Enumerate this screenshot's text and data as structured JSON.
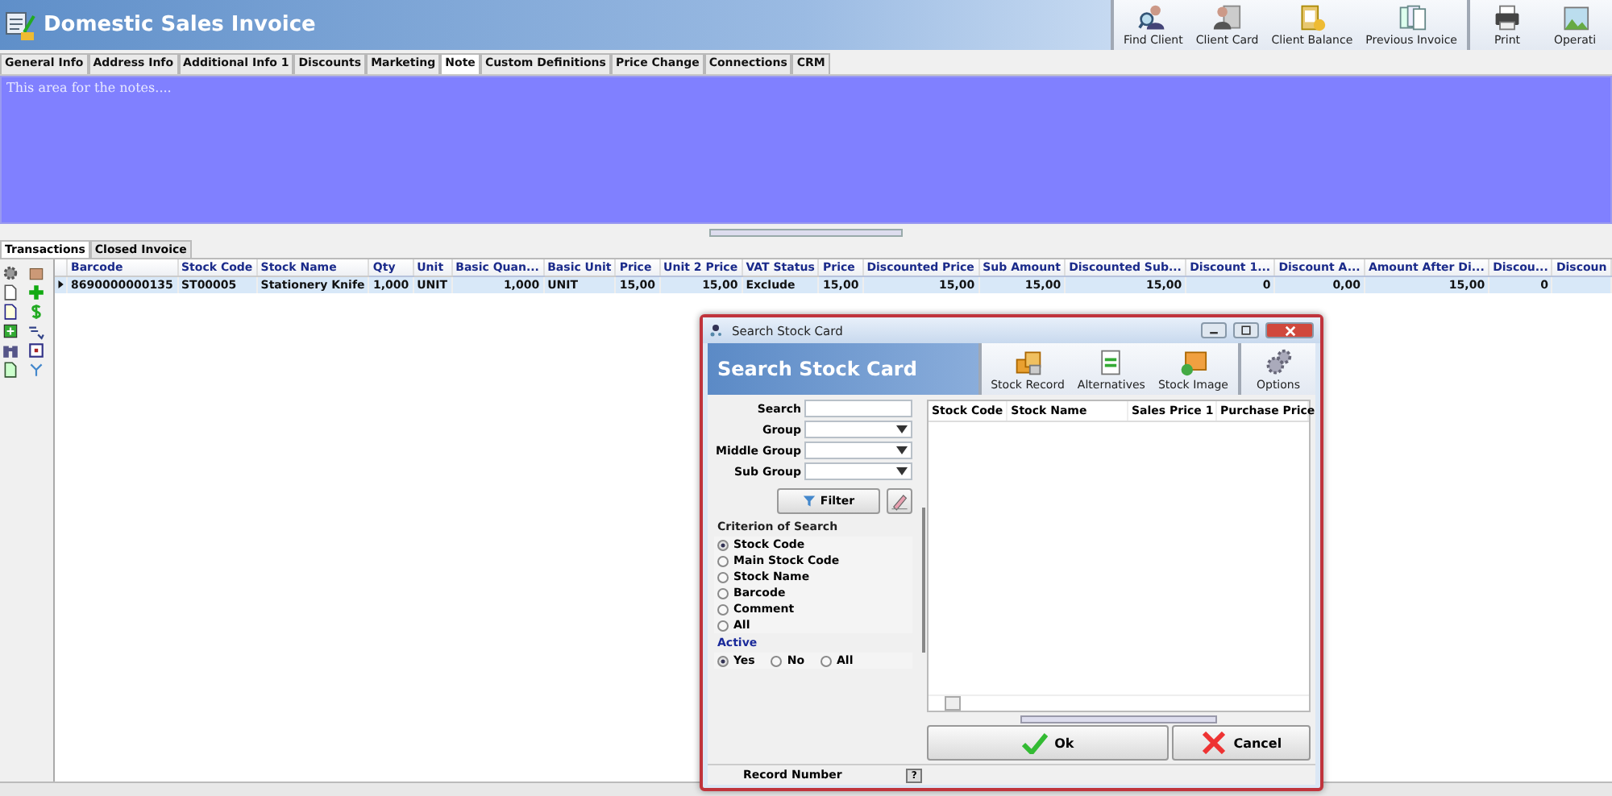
{
  "window": {
    "title": "Domestic Sales Invoice"
  },
  "toolbar": [
    [
      {
        "label": "Find Client",
        "kind": "find"
      },
      {
        "label": "Client Card",
        "kind": "card"
      },
      {
        "label": "Client Balance",
        "kind": "balance"
      },
      {
        "label": "Previous Invoice",
        "kind": "previous"
      }
    ],
    [
      {
        "label": "Print",
        "kind": "print"
      },
      {
        "label": "Operati",
        "kind": "operations"
      }
    ]
  ],
  "tabs": [
    {
      "label": "General Info",
      "selected": false
    },
    {
      "label": "Address Info",
      "selected": false
    },
    {
      "label": "Additional Info 1",
      "selected": false
    },
    {
      "label": "Discounts",
      "selected": false
    },
    {
      "label": "Marketing",
      "selected": false
    },
    {
      "label": "Note",
      "selected": true
    },
    {
      "label": "Custom Definitions",
      "selected": false
    },
    {
      "label": "Price Change",
      "selected": false
    },
    {
      "label": "Connections",
      "selected": false
    },
    {
      "label": "CRM",
      "selected": false
    }
  ],
  "note": {
    "placeholder": "This area for the notes...."
  },
  "bottom_tabs": [
    {
      "label": "Transactions",
      "selected": true
    },
    {
      "label": "Closed Invoice",
      "selected": false
    }
  ],
  "grid": {
    "columns": [
      {
        "label": "Barcode",
        "numeric": false
      },
      {
        "label": "Stock Code",
        "numeric": false
      },
      {
        "label": "Stock Name",
        "numeric": false
      },
      {
        "label": "Qty",
        "numeric": true
      },
      {
        "label": "Unit",
        "numeric": false
      },
      {
        "label": "Basic Quan...",
        "numeric": true
      },
      {
        "label": "Basic Unit",
        "numeric": false
      },
      {
        "label": "Price",
        "numeric": true
      },
      {
        "label": "Unit 2 Price",
        "numeric": true
      },
      {
        "label": "VAT Status",
        "numeric": false
      },
      {
        "label": "Price",
        "numeric": true
      },
      {
        "label": "Discounted Price",
        "numeric": true
      },
      {
        "label": "Sub Amount",
        "numeric": true
      },
      {
        "label": "Discounted Sub...",
        "numeric": true
      },
      {
        "label": "Discount 1...",
        "numeric": true
      },
      {
        "label": "Discount A...",
        "numeric": true
      },
      {
        "label": "Amount After Di...",
        "numeric": true
      },
      {
        "label": "Discou...",
        "numeric": true
      },
      {
        "label": "Discoun",
        "numeric": true
      }
    ],
    "rows": [
      {
        "selected": true,
        "cells": [
          "8690000000135",
          "ST00005",
          "Stationery Knife",
          "1,000",
          "UNIT",
          "1,000",
          "UNIT",
          "15,00",
          "15,00",
          "Exclude",
          "15,00",
          "15,00",
          "15,00",
          "15,00",
          "0",
          "0,00",
          "15,00",
          "0"
        ]
      }
    ]
  },
  "dialog": {
    "title": "Search Stock Card",
    "heading": "Search Stock Card",
    "toolbar": [
      [
        {
          "label": "Stock Record",
          "kind": "record"
        },
        {
          "label": "Alternatives",
          "kind": "alternatives"
        },
        {
          "label": "Stock Image",
          "kind": "image"
        }
      ],
      [
        {
          "label": "Options",
          "kind": "options"
        }
      ]
    ],
    "fields": [
      {
        "label": "Search",
        "kind": "text"
      },
      {
        "label": "Group",
        "kind": "dropdown"
      },
      {
        "label": "Middle Group",
        "kind": "dropdown"
      },
      {
        "label": "Sub Group",
        "kind": "dropdown"
      }
    ],
    "filter_button": "Filter",
    "criterion": {
      "title": "Criterion of Search",
      "options": [
        {
          "label": "Stock Code",
          "selected": true
        },
        {
          "label": "Main Stock Code",
          "selected": false
        },
        {
          "label": "Stock Name",
          "selected": false
        },
        {
          "label": "Barcode",
          "selected": false
        },
        {
          "label": "Comment",
          "selected": false
        },
        {
          "label": "All",
          "selected": false
        }
      ]
    },
    "active": {
      "title": "Active",
      "options": [
        {
          "label": "Yes",
          "selected": true
        },
        {
          "label": "No",
          "selected": false
        },
        {
          "label": "All",
          "selected": false
        }
      ]
    },
    "results": {
      "columns": [
        "Stock Code",
        "Stock Name",
        "Sales Price 1",
        "Purchase Price"
      ]
    },
    "buttons": [
      {
        "label": "Ok",
        "kind": "ok"
      },
      {
        "label": "Cancel",
        "kind": "cancel"
      }
    ],
    "status": {
      "label": "Record Number",
      "help": "?"
    }
  }
}
